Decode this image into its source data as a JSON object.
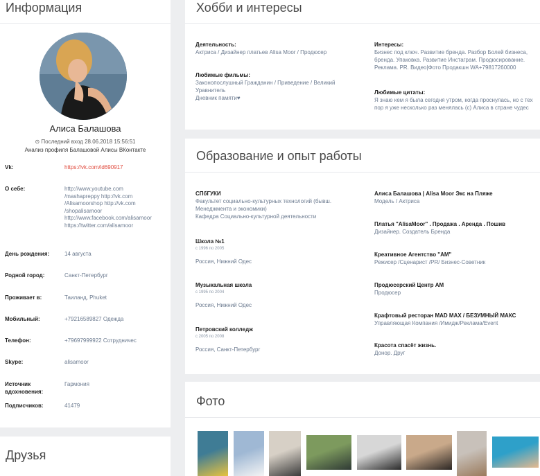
{
  "info": {
    "title": "Информация",
    "name": "Алиса Балашова",
    "last_seen": "⊙ Последний вход 28.06.2018 15:56:51",
    "analysis": "Анализ профиля Балашовой Алисы ВКонтакте",
    "rows": [
      {
        "label": "Vk:",
        "value": "https://vk.com/id690917"
      },
      {
        "label": "О себе:",
        "value": "http://www.youtube.com\n/mashapreppy http://vk.com\n/Alisamoorshop http://vk.com\n/shopalisamoor\nhttp://www.facebook.com/alisamoor\nhttps://twitter.com/alisamoor"
      },
      {
        "label": "День рождения:",
        "value": "14 августа"
      },
      {
        "label": "Родной город:",
        "value": "Санкт-Петербург"
      },
      {
        "label": "Проживает в:",
        "value": "Таиланд, Phuket"
      },
      {
        "label": "Мобильный:",
        "value": "+79216589827 Одежда"
      },
      {
        "label": "Телефон:",
        "value": "+79697999922 Сотрудничес"
      },
      {
        "label": "Skype:",
        "value": "alisamoor"
      },
      {
        "label": "Источник\nвдохновения:",
        "value": "Гармония"
      },
      {
        "label": "Подписчиков:",
        "value": "41479"
      }
    ]
  },
  "friends": {
    "title": "Друзья"
  },
  "hobbies": {
    "title": "Хобби и интересы",
    "activity_h": "Деятельность:",
    "activity": "Актриса / Дизайнер платьев Alisa Moor / Продюсер",
    "films_h": "Любимые фильмы:",
    "films": "Законопослушный Гражданин / Приведение / Великий\nУравнитель\nДневник памяти♥",
    "interests_h": "Интересы:",
    "interests": "Бизнес под ключ. Развитие бренда. Разбор Болей бизнеса,\nбренда. Упаковка. Развитие Инстаграм. Продюсирование.\nРеклама. PR. Видео|Фото Продакшн WA+79817260000",
    "quotes_h": "Любимые цитаты:",
    "quotes": "Я знаю кем я была сегодня утром, когда проснулась, но с тех\nпор я уже несколько раз менялась (с) Алиса в стране чудес"
  },
  "education": {
    "title": "Образование и опыт работы",
    "left": [
      {
        "h": "СПбГУКИ",
        "t": "Факультет социально-культурных технологий (бывш.\nМенеджмента и экономики)\nКафедра Социально-культурной деятельности",
        "y": ""
      },
      {
        "h": "Школа №1",
        "y": "с 1996 по 2005",
        "t": "Россия, Нижний Одес"
      },
      {
        "h": "Музыкальная школа",
        "y": "с 1995 по 2004",
        "t": "Россия, Нижний Одес"
      },
      {
        "h": "Петровский колледж",
        "y": "с 2005 по 2008",
        "t": "Россия, Санкт-Петербург"
      }
    ],
    "right": [
      {
        "h": "Алиса Балашова | Alisa Moor Экс на Пляже",
        "t": "Модель / Актриса"
      },
      {
        "h": "Платья \"AlisaMoor\" . Продажа . Аренда . Пошив",
        "t": "Дизайнер. Создатель Бренда"
      },
      {
        "h": "Креативное Агентство \"AM\"",
        "t": "Режисер /Сценарист /PR/ Бизнес-Советник"
      },
      {
        "h": "Продюсерский Центр AM",
        "t": "Продюсер"
      },
      {
        "h": "Крафтовый ресторан MAD MAX / БЕЗУМНЫЙ МАКС",
        "t": "Управляющая Компания /Имидж/Реклама/Event"
      },
      {
        "h": "Красота спасёт жизнь.",
        "t": "Донор. Друг"
      }
    ]
  },
  "photos": {
    "title": "Фото",
    "colors": [
      [
        "#3f7c95",
        "#e8c33f"
      ],
      [
        "#9fb8d4",
        "#f4f4f4"
      ],
      [
        "#d7d0c6",
        "#3b3b3b"
      ],
      [
        "#7d9a5e",
        "#2f3a35"
      ],
      [
        "#d7d7d7",
        "#2a2a2a"
      ],
      [
        "#c9a98a",
        "#2c2724"
      ],
      [
        "#c8c1ba",
        "#9a7a5c"
      ],
      [
        "#2ea0c9",
        "#e6b98f"
      ]
    ]
  },
  "colors": {
    "link": "#e0493c",
    "accent": "#6b7a8f",
    "background": "#edeef0"
  }
}
